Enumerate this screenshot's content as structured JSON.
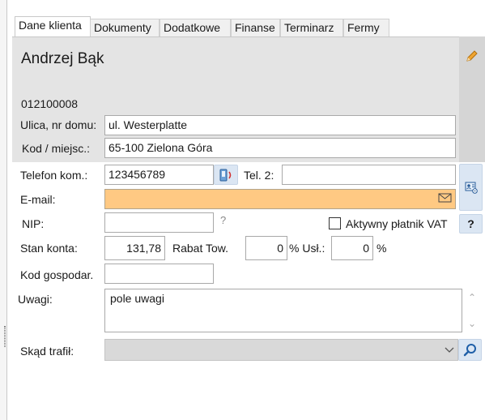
{
  "tabs": [
    {
      "label": "Dane klienta"
    },
    {
      "label": "Dokumenty"
    },
    {
      "label": "Dodatkowe"
    },
    {
      "label": "Finanse"
    },
    {
      "label": "Terminarz"
    },
    {
      "label": "Fermy"
    }
  ],
  "header": {
    "client_name": "Andrzej Bąk",
    "client_code": "012100008",
    "edit_icon": "pencil-icon"
  },
  "address": {
    "street_label": "Ulica, nr domu:",
    "street_value": "ul. Westerplatte",
    "city_label": "Kod / miejsc.:",
    "city_value": "65-100 Zielona Góra"
  },
  "contact": {
    "mobile_label": "Telefon kom.:",
    "mobile_value": "123456789",
    "tel2_label": "Tel. 2:",
    "tel2_value": "",
    "email_label": "E-mail:",
    "email_value": ""
  },
  "tax": {
    "nip_label": "NIP:",
    "nip_value": "",
    "nip_help": "?",
    "vat_label": "Aktywny płatnik VAT",
    "vat_checked": false,
    "help_button": "?"
  },
  "balance": {
    "stan_label": "Stan konta:",
    "stan_value": "131,78",
    "rabat_label": "Rabat Tow.",
    "rabat_value": "0",
    "rabat_unit": "% Usł.:",
    "usl_value": "0",
    "usl_unit": "%"
  },
  "gosp": {
    "label": "Kod gospodar.",
    "value": ""
  },
  "notes": {
    "label": "Uwagi:",
    "value": "pole uwagi"
  },
  "source": {
    "label": "Skąd trafił:",
    "value": ""
  },
  "colors": {
    "email_bg": "#ffc983",
    "head_bg": "#e4e4e4",
    "button_bg": "#dbe6f3"
  }
}
